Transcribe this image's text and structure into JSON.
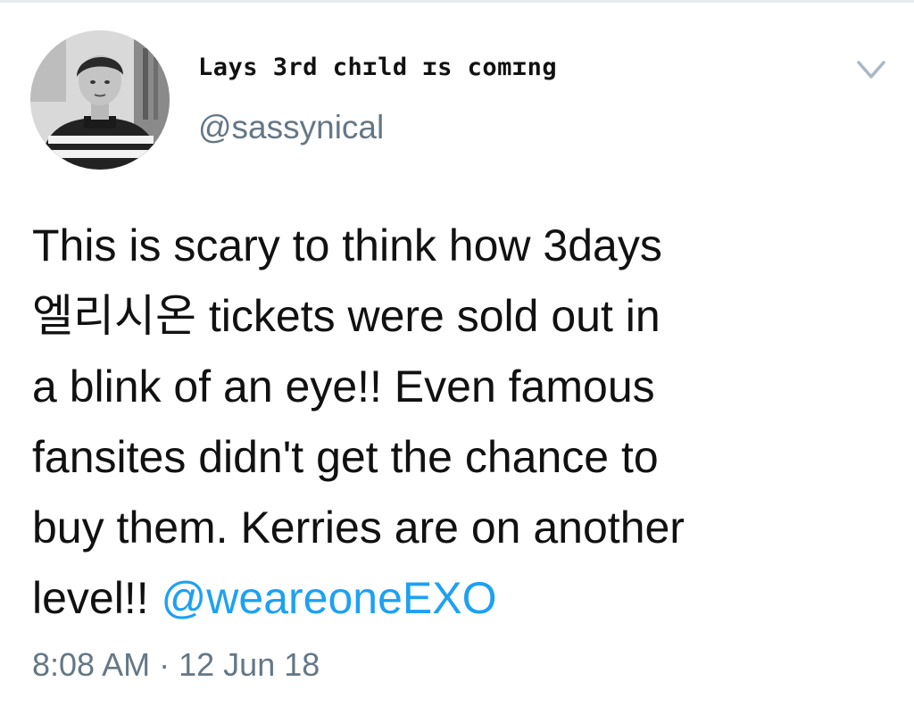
{
  "tweet": {
    "author": {
      "display_name": "Lays 3rd chɪld ɪs comɪng",
      "handle": "@sassynical"
    },
    "body": {
      "lines": [
        "This is scary to think how 3days",
        "엘리시온 tickets were sold out in",
        "a blink of an eye!! Even famous",
        "fansites didn't get the chance to",
        "buy them. Kerries are on another",
        "level!! "
      ],
      "mention": "@weareoneEXO"
    },
    "time": "8:08 AM",
    "separator": "·",
    "date": "12 Jun 18"
  },
  "icons": {
    "menu": "chevron-down-icon"
  },
  "colors": {
    "link": "#1da1f2",
    "secondary_text": "#657786",
    "text": "#111111"
  }
}
